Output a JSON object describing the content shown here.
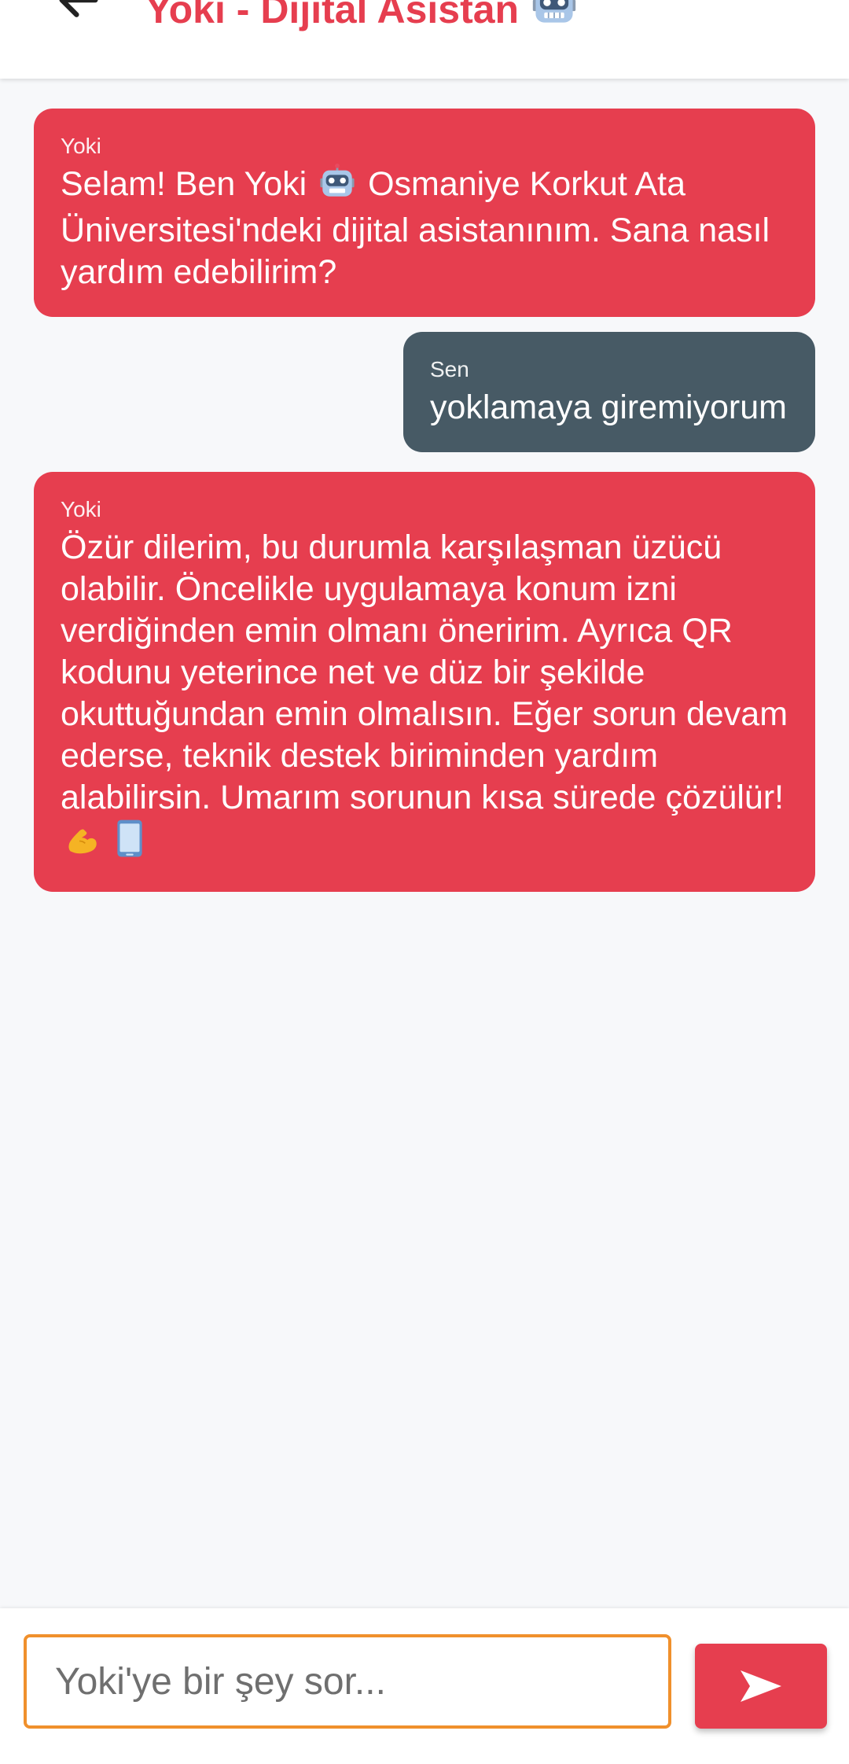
{
  "header": {
    "title": "Yoki - Dijital Asistan",
    "title_icon": "robot-icon",
    "back_icon": "arrow-left-icon"
  },
  "messages": [
    {
      "sender": "Yoki",
      "role": "bot",
      "text_before": "Selam! Ben Yoki",
      "inline_icon": "robot-icon",
      "text_after": "Osmaniye Korkut Ata Üniversitesi'ndeki dijital asistanınım. Sana nasıl yardım edebilirim?"
    },
    {
      "sender": "Sen",
      "role": "user",
      "text": "yoklamaya giremiyorum"
    },
    {
      "sender": "Yoki",
      "role": "bot",
      "text": "Özür dilerim, bu durumla karşılaşman üzücü olabilir. Öncelikle uygulamaya konum izni verdiğinden emin olmanı öneririm. Ayrıca QR kodunu yeterince net ve düz bir şekilde okuttuğundan emin olmalısın. Eğer sorun devam ederse, teknik destek biriminden yardım alabilirsin. Umarım sorunun kısa sürede çözülür!",
      "trailing_icons": [
        "flexed-biceps-icon",
        "mobile-phone-icon"
      ]
    }
  ],
  "input": {
    "placeholder": "Yoki'ye bir şey sor...",
    "value": ""
  },
  "send_button": {
    "icon": "send-arrow-icon"
  },
  "colors": {
    "bot_bubble": "#e63e4f",
    "user_bubble": "#475a65",
    "accent": "#e63e4f",
    "input_border": "#f0902c",
    "background": "#f7f8fa"
  }
}
